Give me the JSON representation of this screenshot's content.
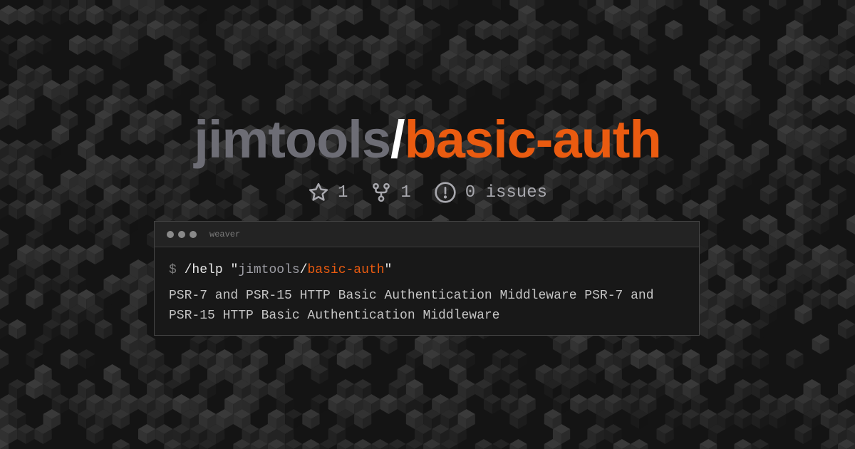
{
  "title": {
    "owner": "jimtools",
    "slash": "/",
    "repo": "basic-auth"
  },
  "stats": {
    "stars": "1",
    "forks": "1",
    "issues": "0 issues"
  },
  "terminal": {
    "window_name": "weaver",
    "prompt": "$",
    "command": "/help",
    "quote_open": "\"",
    "quote_close": "\"",
    "arg_owner": "jimtools",
    "arg_slash": "/",
    "arg_repo": "basic-auth",
    "description": "PSR-7 and PSR-15 HTTP Basic Authentication Middleware PSR-7 and PSR-15 HTTP Basic Authentication Middleware"
  },
  "icons": {
    "stars": "star-icon",
    "forks": "fork-icon",
    "issues": "issue-icon"
  },
  "colors": {
    "background": "#141414",
    "owner": "#6d6d75",
    "slash": "#ffffff",
    "repo": "#ea5b10",
    "stat_text": "#a8a8ae"
  }
}
